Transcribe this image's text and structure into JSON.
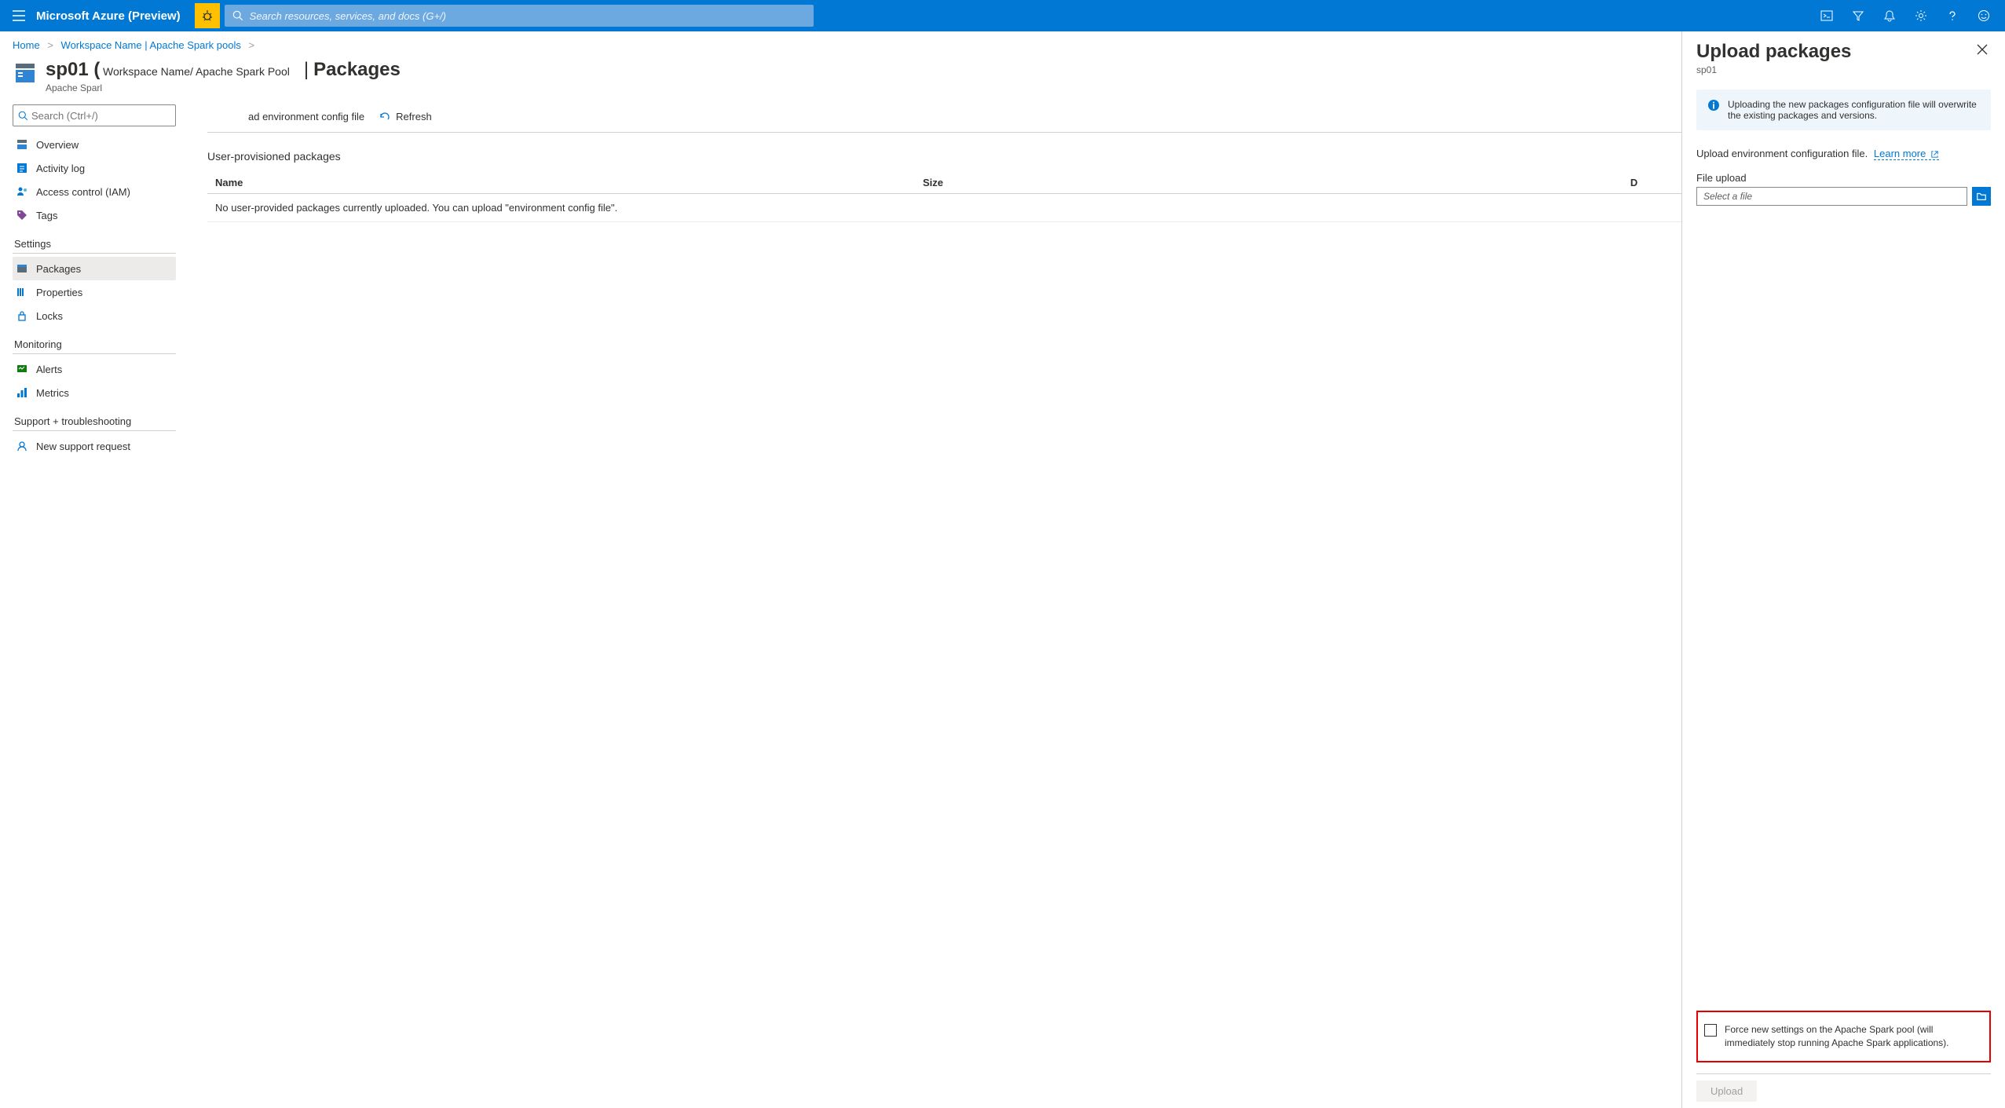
{
  "topbar": {
    "brand": "Microsoft Azure (Preview)",
    "search_placeholder": "Search resources, services, and docs (G+/)"
  },
  "breadcrumb": {
    "home": "Home",
    "workspace": "Workspace Name | Apache Spark pools"
  },
  "resource": {
    "name": "sp01 (",
    "path": "Workspace Name/ Apache Spark Pool",
    "type": "Apache Sparl",
    "page_title": "Packages"
  },
  "sidebar": {
    "search_placeholder": "Search (Ctrl+/)",
    "items_top": [
      {
        "label": "Overview"
      },
      {
        "label": "Activity log"
      },
      {
        "label": "Access control (IAM)"
      },
      {
        "label": "Tags"
      }
    ],
    "section_settings": "Settings",
    "items_settings": [
      {
        "label": "Packages",
        "active": true
      },
      {
        "label": "Properties"
      },
      {
        "label": "Locks"
      }
    ],
    "section_monitoring": "Monitoring",
    "items_monitoring": [
      {
        "label": "Alerts"
      },
      {
        "label": "Metrics"
      }
    ],
    "section_support": "Support + troubleshooting",
    "items_support": [
      {
        "label": "New support request"
      }
    ]
  },
  "toolbar": {
    "upload": "ad environment config file",
    "refresh": "Refresh"
  },
  "table": {
    "section": "User-provisioned packages",
    "col_name": "Name",
    "col_size": "Size",
    "col_date": "D",
    "empty": "No user-provided packages currently uploaded. You can upload \"environment config file\"."
  },
  "panel": {
    "title": "Upload packages",
    "subtitle": "sp01",
    "info": "Uploading the new packages configuration file will overwrite the existing packages and versions.",
    "desc": "Upload environment configuration file.",
    "learn_more": "Learn more",
    "file_label": "File upload",
    "file_placeholder": "Select a file",
    "checkbox": "Force new settings on the Apache Spark pool (will immediately stop running Apache Spark applications).",
    "upload_btn": "Upload"
  }
}
